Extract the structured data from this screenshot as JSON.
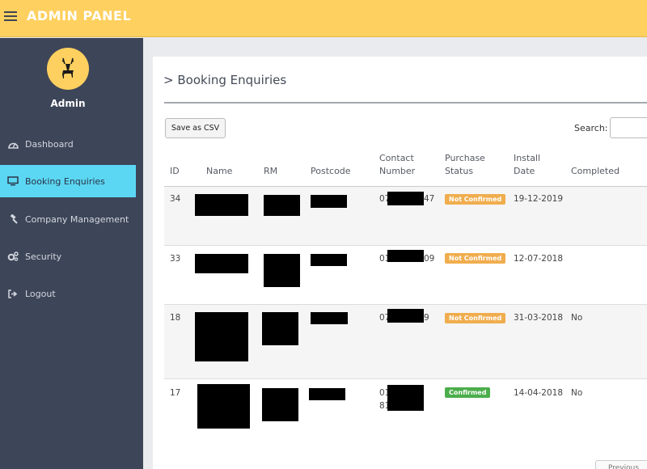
{
  "header": {
    "title": "ADMIN PANEL"
  },
  "user": {
    "name": "Admin"
  },
  "sidebar": {
    "items": [
      {
        "label": "Dashboard",
        "icon": "dashboard-icon"
      },
      {
        "label": "Booking Enquiries",
        "icon": "monitor-icon",
        "active": true
      },
      {
        "label": "Company Management",
        "icon": "gavel-icon"
      },
      {
        "label": "Security",
        "icon": "cogs-icon"
      },
      {
        "label": "Logout",
        "icon": "logout-icon"
      }
    ]
  },
  "page": {
    "title": "Booking Enquiries",
    "csv_label": "Save as CSV",
    "search_label": "Search:",
    "prev_label": "Previous"
  },
  "table": {
    "headers": {
      "id": "ID",
      "name": "Name",
      "rm": "RM",
      "postcode": "Postcode",
      "contact_1": "Contact",
      "contact_2": "Number",
      "purchase_1": "Purchase",
      "purchase_2": "Status",
      "install_1": "Install",
      "install_2": "Date",
      "completed": "Completed"
    },
    "rows": [
      {
        "id": "34",
        "contact_prefix": "07",
        "contact_suffix": "47",
        "status": "Not Confirmed",
        "install_date": "19-12-2019",
        "completed": ""
      },
      {
        "id": "33",
        "contact_prefix": "01",
        "contact_suffix": "09",
        "status": "Not Confirmed",
        "install_date": "12-07-2018",
        "completed": ""
      },
      {
        "id": "18",
        "contact_prefix": "07",
        "contact_suffix": "9",
        "status": "Not Confirmed",
        "install_date": "31-03-2018",
        "completed": "No"
      },
      {
        "id": "17",
        "contact_prefix": "01",
        "contact_prefix_2": "81",
        "contact_suffix": "",
        "status": "Confirmed",
        "install_date": "14-04-2018",
        "completed": "No"
      }
    ]
  },
  "colors": {
    "topbar": "#fed060",
    "sidebar": "#3d4558",
    "active_item": "#5bd7f3",
    "badge_not_confirmed": "#f0ad4e",
    "badge_confirmed": "#4cae4c"
  }
}
